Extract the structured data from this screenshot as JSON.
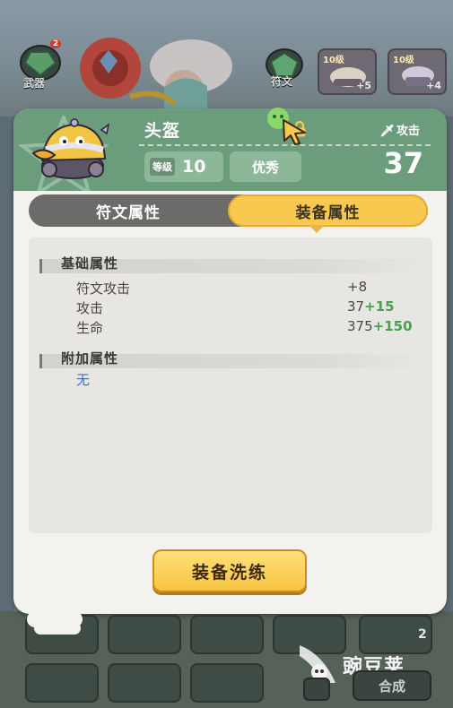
{
  "hud": {
    "weapon_label": "武器",
    "rune_label": "符文",
    "weapon_badge": "2",
    "equip_tiles": [
      {
        "level": "10级",
        "plus": "+5"
      },
      {
        "level": "10级",
        "plus": "+4"
      }
    ]
  },
  "panel": {
    "item_name": "头盔",
    "stat_label": "攻击",
    "stat_value": "37",
    "level_label": "等级",
    "level_value": "10",
    "quality": "优秀",
    "tabs": [
      {
        "label": "符文属性",
        "active": false
      },
      {
        "label": "装备属性",
        "active": true
      }
    ],
    "sections": {
      "base_title": "基础属性",
      "base_attrs": [
        {
          "name": "符文攻击",
          "value": "+8",
          "bonus": ""
        },
        {
          "name": "攻击",
          "value": "37",
          "bonus": "+15"
        },
        {
          "name": "生命",
          "value": "375",
          "bonus": "+150"
        }
      ],
      "extra_title": "附加属性",
      "extra_none": "无"
    },
    "refine_button": "装备洗练"
  },
  "bottom": {
    "merge_label": "合成",
    "count": "2",
    "watermark": "豌豆荚"
  },
  "colors": {
    "header_green": "#6b9d7c",
    "tab_active": "#f7c94e",
    "bonus_green": "#46a24a",
    "none_blue": "#3f6fb4"
  }
}
